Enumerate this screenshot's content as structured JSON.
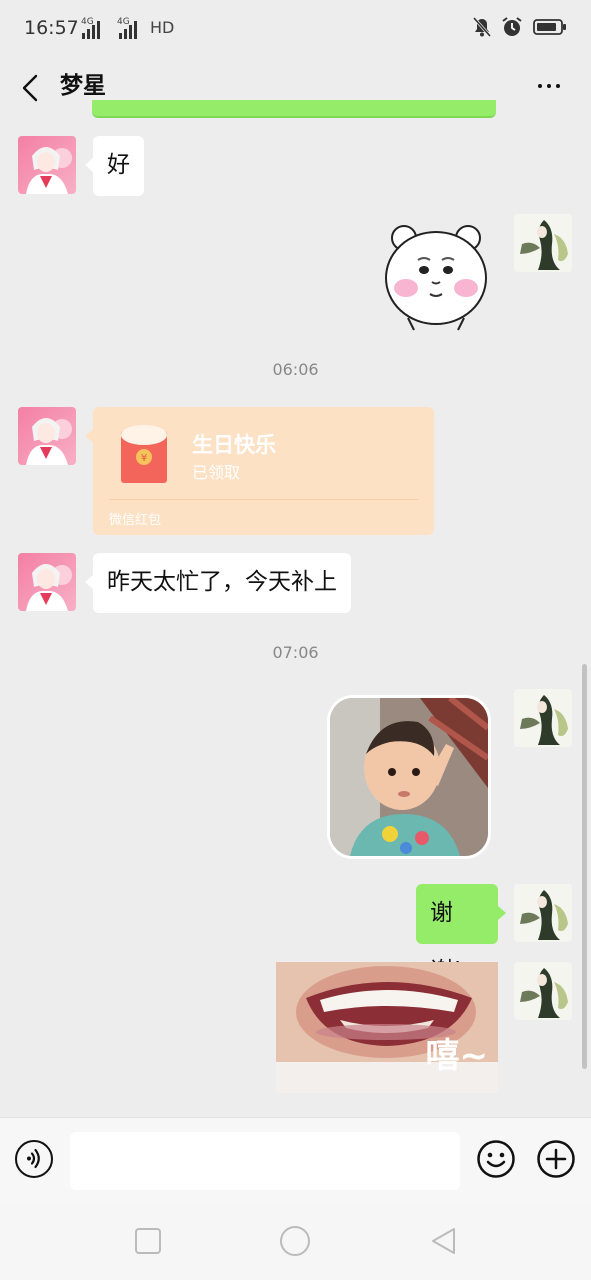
{
  "status_bar": {
    "time": "16:57",
    "signal1_label": "4G",
    "signal2_label": "4G",
    "hd_label": "HD",
    "icons": [
      "mute-icon",
      "alarm-icon",
      "battery-icon"
    ]
  },
  "header": {
    "title": "梦星",
    "back_icon": "chevron-left-icon",
    "more_icon": "more-dots-icon"
  },
  "messages": {
    "m1_text": "好",
    "time1": "06:06",
    "red_packet": {
      "title": "生日快乐",
      "status": "已领取",
      "footer": "微信红包"
    },
    "m3_text": "昨天太忙了，今天补上",
    "time2": "07:06",
    "m5_text": "谢谢!",
    "sticker_caption": "嘻~"
  },
  "input_bar": {
    "placeholder": "",
    "voice_icon": "voice-icon",
    "emoji_icon": "emoji-icon",
    "plus_icon": "plus-icon"
  },
  "nav_bar": {
    "icons": [
      "square-recents-icon",
      "circle-home-icon",
      "triangle-back-icon"
    ]
  },
  "colors": {
    "background": "#ededed",
    "my_bubble": "#95ec69",
    "their_bubble": "#ffffff",
    "red_packet": "#fde1c5"
  }
}
